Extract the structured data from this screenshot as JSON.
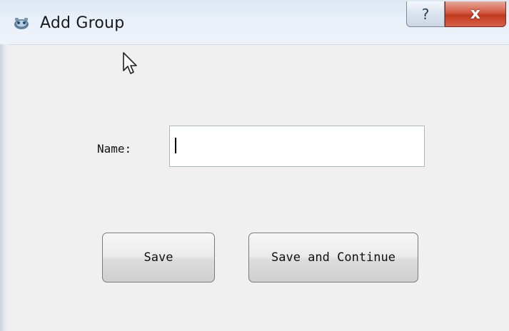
{
  "window": {
    "title": "Add Group",
    "icon": "app-icon",
    "controls": {
      "help_label": "?",
      "close_label": "x"
    }
  },
  "form": {
    "name_label": "Name:",
    "name_value": ""
  },
  "buttons": {
    "save_label": "Save",
    "save_continue_label": "Save and Continue"
  },
  "colors": {
    "titlebar": "#dde8f4",
    "close": "#c0391f",
    "background": "#f0f0f0"
  }
}
